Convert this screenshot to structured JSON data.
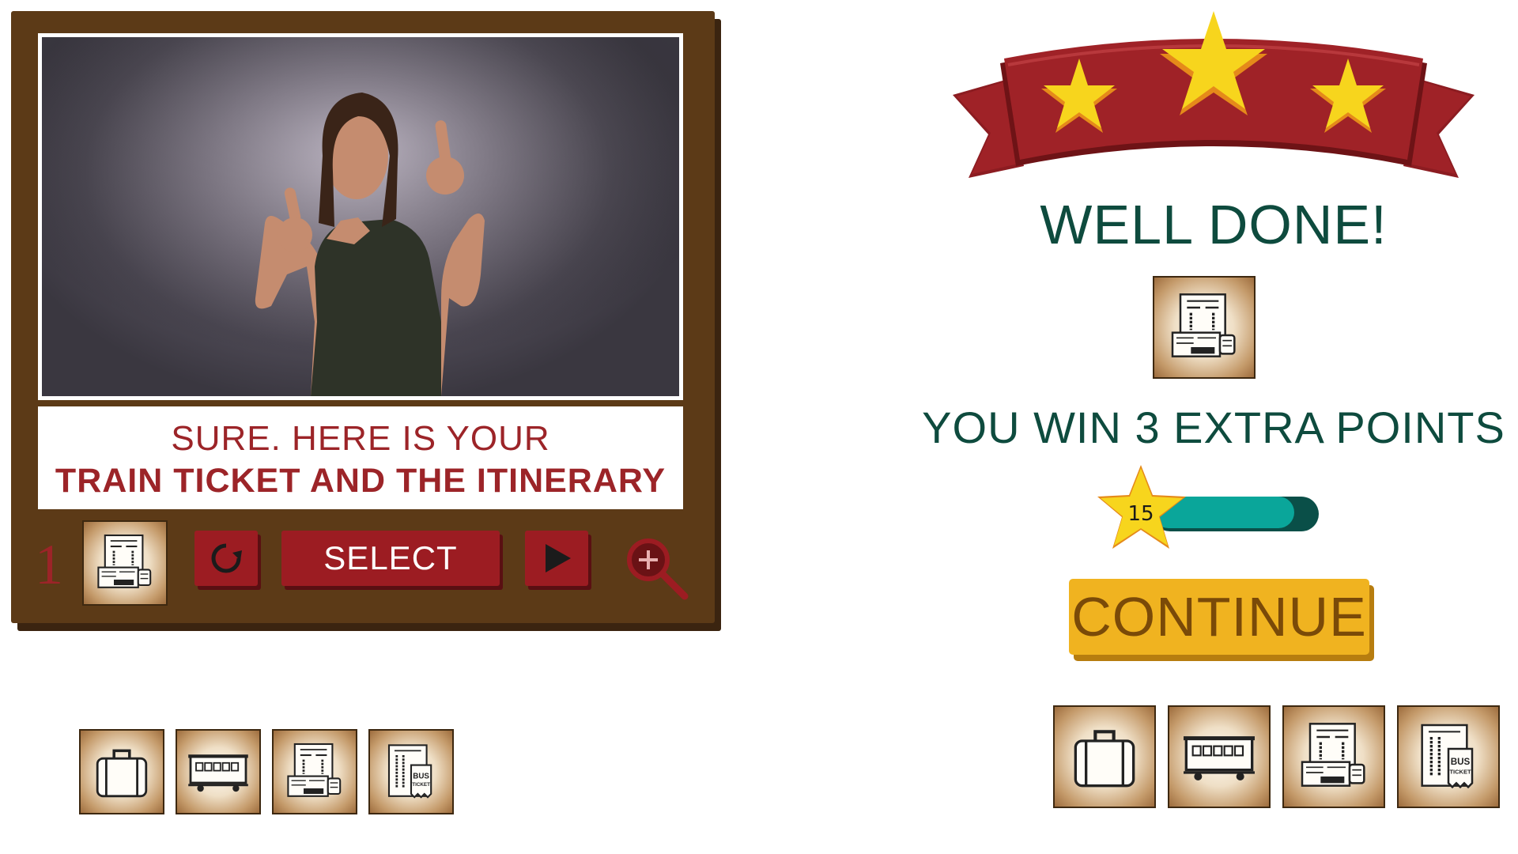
{
  "video_panel": {
    "caption_line1": "SURE. HERE IS YOUR",
    "caption_line2": "TRAIN TICKET AND THE ITINERARY",
    "item_number": "1",
    "selected_item_icon": "train-ticket-itinerary-icon",
    "replay_icon": "replay-icon",
    "select_label": "SELECT",
    "play_icon": "play-icon",
    "zoom_icon": "zoom-in-icon"
  },
  "left_items": [
    {
      "icon": "suitcase-icon"
    },
    {
      "icon": "train-car-icon"
    },
    {
      "icon": "train-ticket-itinerary-icon"
    },
    {
      "icon": "bus-ticket-icon"
    }
  ],
  "result": {
    "stars_earned": 3,
    "stars_total": 3,
    "title": "WELL DONE!",
    "reward_item_icon": "train-ticket-itinerary-icon",
    "message": "YOU WIN 3 EXTRA POINTS",
    "score": "15",
    "score_progress": 0.85,
    "continue_label": "CONTINUE"
  },
  "right_items": [
    {
      "icon": "suitcase-icon"
    },
    {
      "icon": "train-car-icon"
    },
    {
      "icon": "train-ticket-itinerary-icon"
    },
    {
      "icon": "bus-ticket-icon"
    }
  ],
  "bus_ticket_text": [
    "BUS",
    "TICKET"
  ],
  "colors": {
    "panel_brown": "#5c3a17",
    "accent_red": "#9c1c22",
    "heading_green": "#0e4b3e",
    "progress_teal": "#0aa69a",
    "star_yellow": "#f7d51d",
    "continue_yellow": "#f0b320"
  }
}
